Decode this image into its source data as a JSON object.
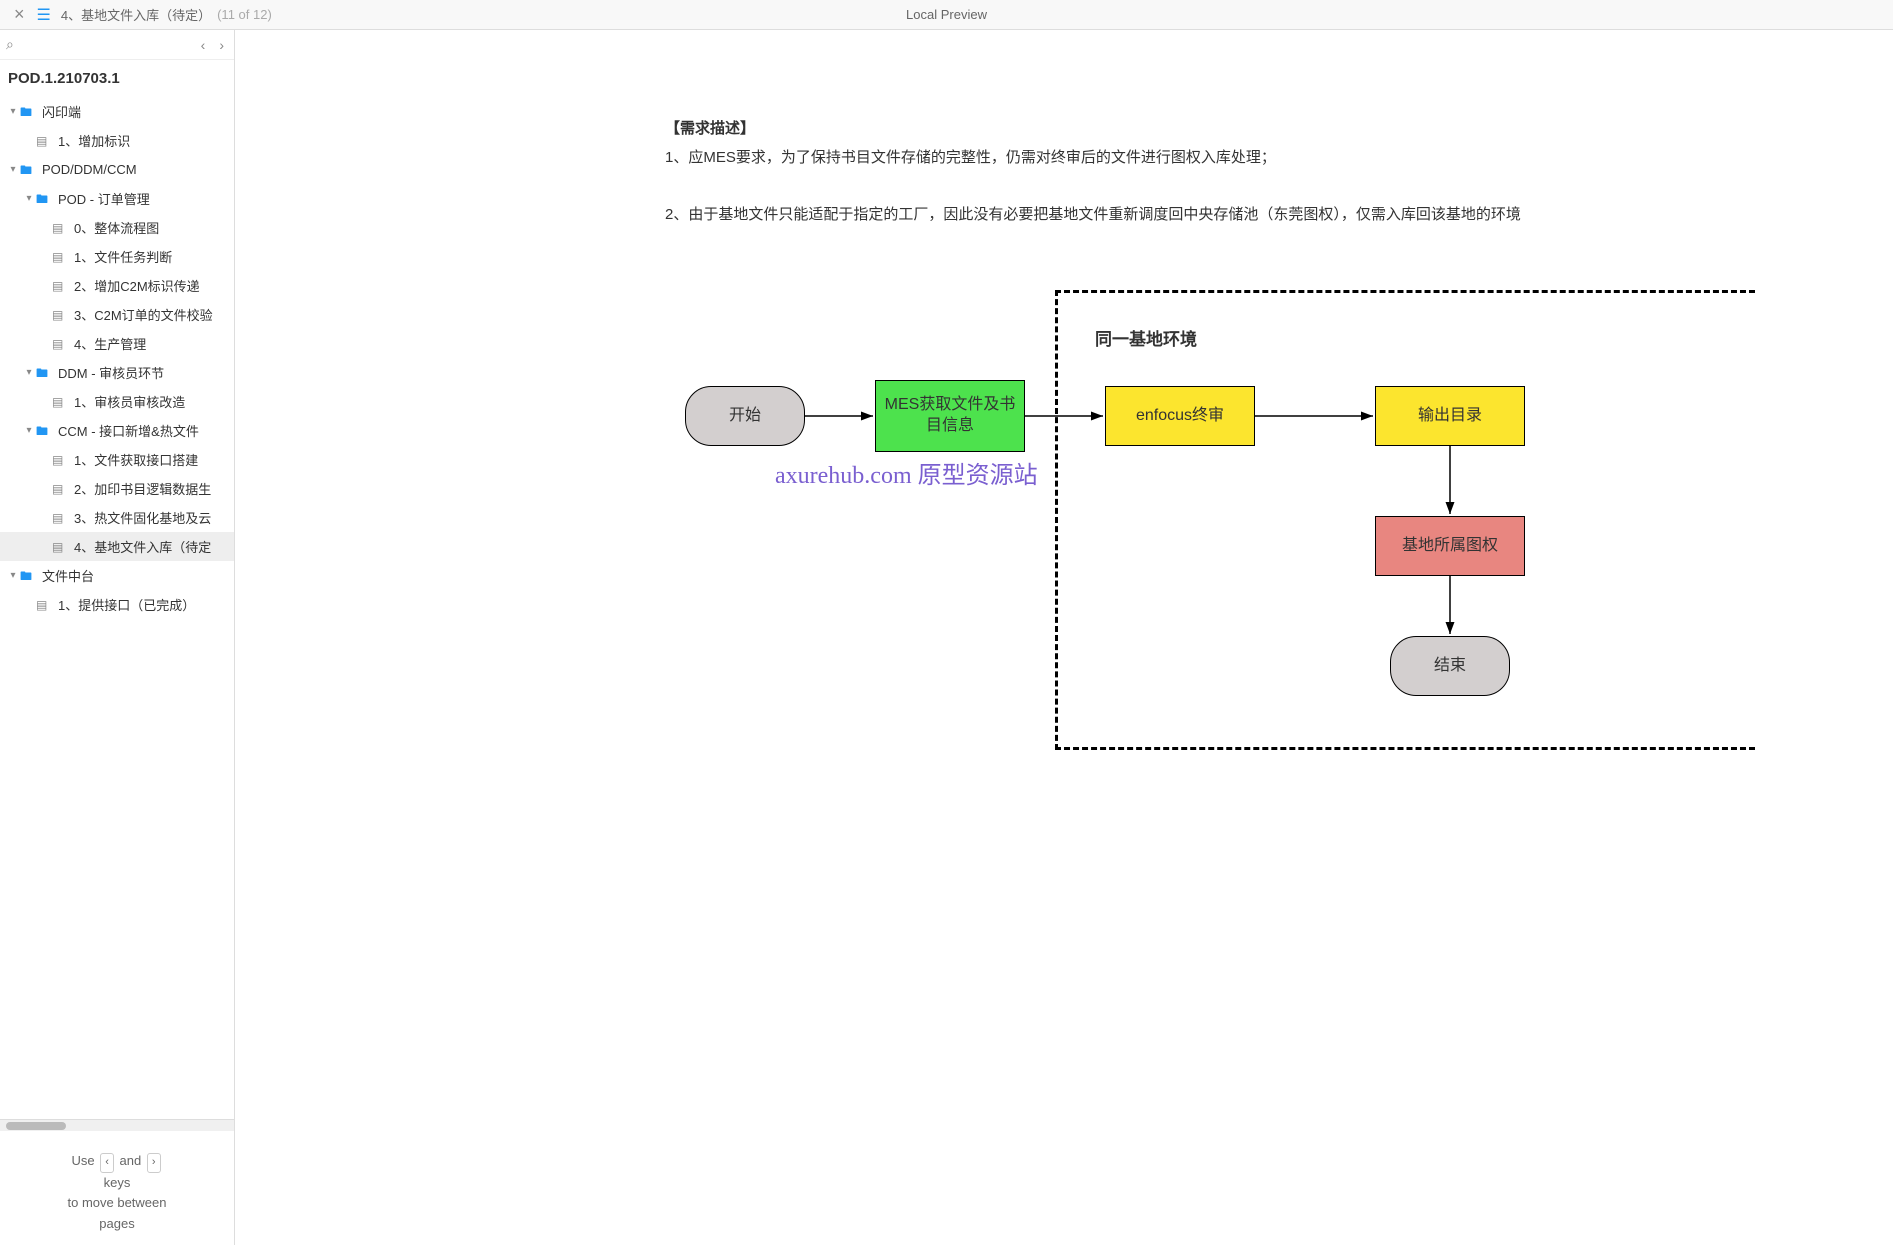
{
  "topbar": {
    "title": "4、基地文件入库（待定）",
    "counter": "(11 of 12)",
    "center": "Local Preview"
  },
  "project_title": "POD.1.210703.1",
  "tree": [
    {
      "type": "folder",
      "label": "闪印端",
      "indent": 1
    },
    {
      "type": "page",
      "label": "1、增加标识",
      "indent": 2
    },
    {
      "type": "folder",
      "label": "POD/DDM/CCM",
      "indent": 1
    },
    {
      "type": "folder",
      "label": "POD - 订单管理",
      "indent": 2
    },
    {
      "type": "page",
      "label": "0、整体流程图",
      "indent": 3
    },
    {
      "type": "page",
      "label": "1、文件任务判断",
      "indent": 3
    },
    {
      "type": "page",
      "label": "2、增加C2M标识传递",
      "indent": 3
    },
    {
      "type": "page",
      "label": "3、C2M订单的文件校验",
      "indent": 3
    },
    {
      "type": "page",
      "label": "4、生产管理",
      "indent": 3
    },
    {
      "type": "folder",
      "label": "DDM - 审核员环节",
      "indent": 2
    },
    {
      "type": "page",
      "label": "1、审核员审核改造",
      "indent": 3
    },
    {
      "type": "folder",
      "label": "CCM - 接口新增&热文件",
      "indent": 2
    },
    {
      "type": "page",
      "label": "1、文件获取接口搭建",
      "indent": 3
    },
    {
      "type": "page",
      "label": "2、加印书目逻辑数据生",
      "indent": 3
    },
    {
      "type": "page",
      "label": "3、热文件固化基地及云",
      "indent": 3
    },
    {
      "type": "page",
      "label": "4、基地文件入库（待定",
      "indent": 3,
      "selected": true
    },
    {
      "type": "folder",
      "label": "文件中台",
      "indent": 1
    },
    {
      "type": "page",
      "label": "1、提供接口（已完成）",
      "indent": 2
    }
  ],
  "hint": {
    "l1a": "Use",
    "l1b": "and",
    "l2": "keys",
    "l3": "to move between",
    "l4": "pages"
  },
  "description": {
    "head": "【需求描述】",
    "p1": "1、应MES要求，为了保持书目文件存储的完整性，仍需对终审后的文件进行图权入库处理；",
    "p2": "2、由于基地文件只能适配于指定的工厂，因此没有必要把基地文件重新调度回中央存储池（东莞图权），仅需入库回该基地的环境"
  },
  "watermark": "axurehub.com 原型资源站",
  "chart_data": {
    "type": "flowchart",
    "group": {
      "label": "同一基地环境",
      "bounds_note": "dashed container around enfocus终审, 输出目录, 基地所属图权, 结束"
    },
    "nodes": [
      {
        "id": "start",
        "label": "开始",
        "shape": "rounded",
        "fill": "#d3cfcf"
      },
      {
        "id": "mes",
        "label": "MES获取文件及书目信息",
        "shape": "rect",
        "fill": "#4de24d"
      },
      {
        "id": "enfocus",
        "label": "enfocus终审",
        "shape": "rect",
        "fill": "#fce52e"
      },
      {
        "id": "output",
        "label": "输出目录",
        "shape": "rect",
        "fill": "#fce52e"
      },
      {
        "id": "base",
        "label": "基地所属图权",
        "shape": "rect",
        "fill": "#e88680"
      },
      {
        "id": "end",
        "label": "结束",
        "shape": "rounded",
        "fill": "#d3cfcf"
      }
    ],
    "edges": [
      {
        "from": "start",
        "to": "mes"
      },
      {
        "from": "mes",
        "to": "enfocus"
      },
      {
        "from": "enfocus",
        "to": "output"
      },
      {
        "from": "output",
        "to": "base"
      },
      {
        "from": "base",
        "to": "end"
      }
    ]
  }
}
